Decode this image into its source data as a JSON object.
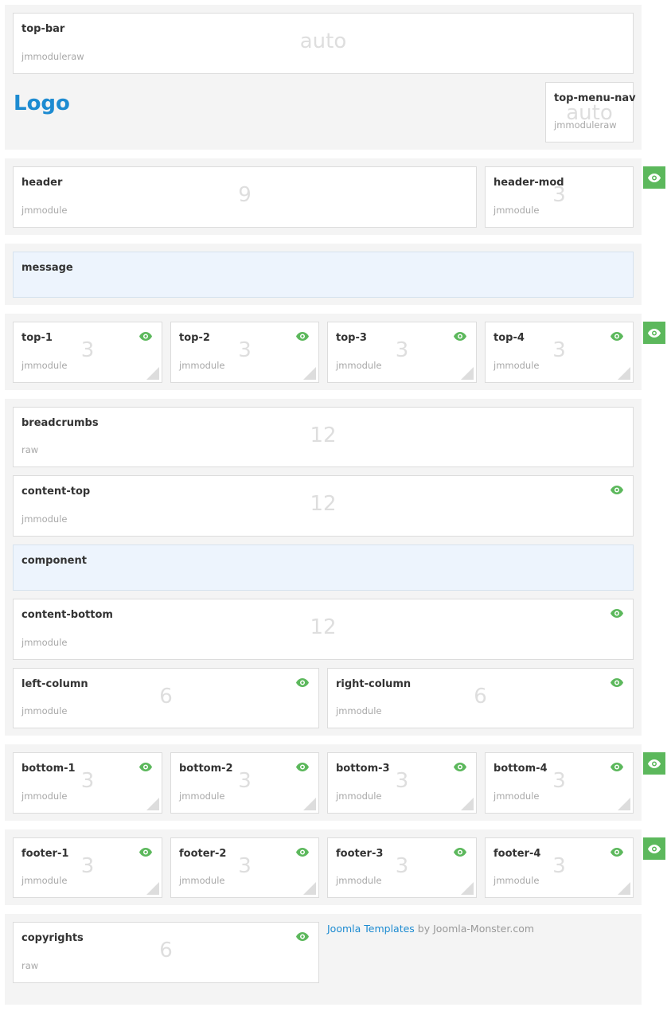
{
  "logo": "Logo",
  "credit": {
    "link": "Joomla Templates",
    "rest": " by Joomla-Monster.com"
  },
  "colors": {
    "accent": "#1d8bd1",
    "eye": "#5cb85c",
    "message_bg": "#edf4fd",
    "section_bg": "#f4f4f4"
  },
  "icons": {
    "visibility": "eye-icon",
    "resize": "resize-handle-icon"
  },
  "top": {
    "top_bar": {
      "name": "top-bar",
      "type": "jmmoduleraw",
      "span": "auto"
    },
    "top_menu_nav": {
      "name": "top-menu-nav",
      "type": "jmmoduleraw",
      "span": "auto"
    }
  },
  "header": {
    "header": {
      "name": "header",
      "type": "jmmodule",
      "span": "9"
    },
    "header_mod": {
      "name": "header-mod",
      "type": "jmmodule",
      "span": "3"
    }
  },
  "message": {
    "name": "message"
  },
  "tops": [
    {
      "name": "top-1",
      "type": "jmmodule",
      "span": "3"
    },
    {
      "name": "top-2",
      "type": "jmmodule",
      "span": "3"
    },
    {
      "name": "top-3",
      "type": "jmmodule",
      "span": "3"
    },
    {
      "name": "top-4",
      "type": "jmmodule",
      "span": "3"
    }
  ],
  "main": {
    "breadcrumbs": {
      "name": "breadcrumbs",
      "type": "raw",
      "span": "12"
    },
    "content_top": {
      "name": "content-top",
      "type": "jmmodule",
      "span": "12"
    },
    "component": {
      "name": "component"
    },
    "content_bottom": {
      "name": "content-bottom",
      "type": "jmmodule",
      "span": "12"
    },
    "left_column": {
      "name": "left-column",
      "type": "jmmodule",
      "span": "6"
    },
    "right_column": {
      "name": "right-column",
      "type": "jmmodule",
      "span": "6"
    }
  },
  "bottoms": [
    {
      "name": "bottom-1",
      "type": "jmmodule",
      "span": "3"
    },
    {
      "name": "bottom-2",
      "type": "jmmodule",
      "span": "3"
    },
    {
      "name": "bottom-3",
      "type": "jmmodule",
      "span": "3"
    },
    {
      "name": "bottom-4",
      "type": "jmmodule",
      "span": "3"
    }
  ],
  "footers": [
    {
      "name": "footer-1",
      "type": "jmmodule",
      "span": "3"
    },
    {
      "name": "footer-2",
      "type": "jmmodule",
      "span": "3"
    },
    {
      "name": "footer-3",
      "type": "jmmodule",
      "span": "3"
    },
    {
      "name": "footer-4",
      "type": "jmmodule",
      "span": "3"
    }
  ],
  "copyrights": {
    "name": "copyrights",
    "type": "raw",
    "span": "6"
  }
}
